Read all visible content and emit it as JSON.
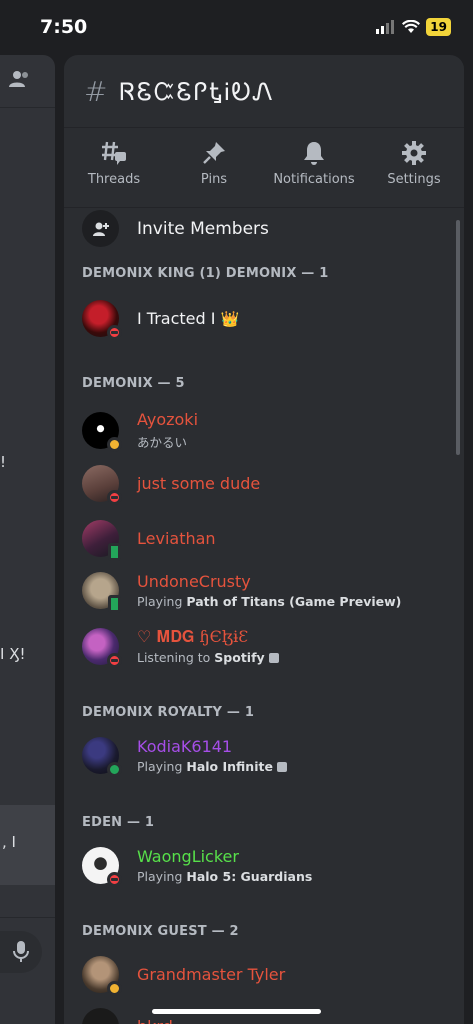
{
  "status_bar": {
    "time": "7:50",
    "battery": "19"
  },
  "channel": {
    "name": "ᏒᏋᏨᏋᎵᎿᎥᎧᏁ"
  },
  "back_panel": {
    "stub1": "!",
    "stub2": "I Ӽ!",
    "stub3": ", I"
  },
  "toolbar": {
    "threads": "Threads",
    "pins": "Pins",
    "notifications": "Notifications",
    "settings": "Settings"
  },
  "invite_label": "Invite Members",
  "sections": [
    {
      "title": "DEMONIX KING (1) DEMONIX — 1"
    },
    {
      "title": "DEMONIX — 5"
    },
    {
      "title": "DEMONIX ROYALTY — 1"
    },
    {
      "title": "EDEN — 1"
    },
    {
      "title": "DEMONIX GUEST — 2"
    }
  ],
  "members": [
    {
      "name": "I Tracted I",
      "color": "#f2f3f5",
      "status": "dnd",
      "sub_prefix": "",
      "sub_bold": "",
      "crown": "👑"
    },
    {
      "name": "Ayozoki",
      "color": "#e5533d",
      "status": "idle",
      "sub_prefix": "あかるい",
      "sub_bold": ""
    },
    {
      "name": "just some dude",
      "color": "#e5533d",
      "status": "dnd",
      "sub_prefix": "",
      "sub_bold": ""
    },
    {
      "name": "Leviathan",
      "color": "#e5533d",
      "status": "mobile",
      "sub_prefix": "",
      "sub_bold": ""
    },
    {
      "name": "UndoneCrusty",
      "color": "#e5533d",
      "status": "mobile",
      "sub_prefix": "Playing ",
      "sub_bold": "Path of Titans (Game Preview)"
    },
    {
      "name": "♡ 𝐌𝐃𝐆 ɧЄɮɨƐ",
      "color": "#e5533d",
      "status": "dnd",
      "sub_prefix": "Listening to ",
      "sub_bold": "Spotify"
    },
    {
      "name": "KodiaK6141",
      "color": "#a64ee8",
      "status": "online",
      "sub_prefix": "Playing ",
      "sub_bold": "Halo Infinite"
    },
    {
      "name": "WaongLicker",
      "color": "#57e04a",
      "status": "dnd",
      "sub_prefix": "Playing ",
      "sub_bold": "Halo 5: Guardians"
    },
    {
      "name": "Grandmaster Tyler",
      "color": "#e5533d",
      "status": "idle",
      "sub_prefix": "",
      "sub_bold": ""
    },
    {
      "name": "bkrd",
      "color": "#e5533d",
      "status": "",
      "sub_prefix": "",
      "sub_bold": ""
    }
  ],
  "icons": {
    "members": "members-icon",
    "threads": "threads-icon",
    "pins": "pin-icon",
    "notifications": "bell-icon",
    "settings": "gear-icon",
    "invite": "add-user-icon",
    "mic": "mic-icon"
  }
}
